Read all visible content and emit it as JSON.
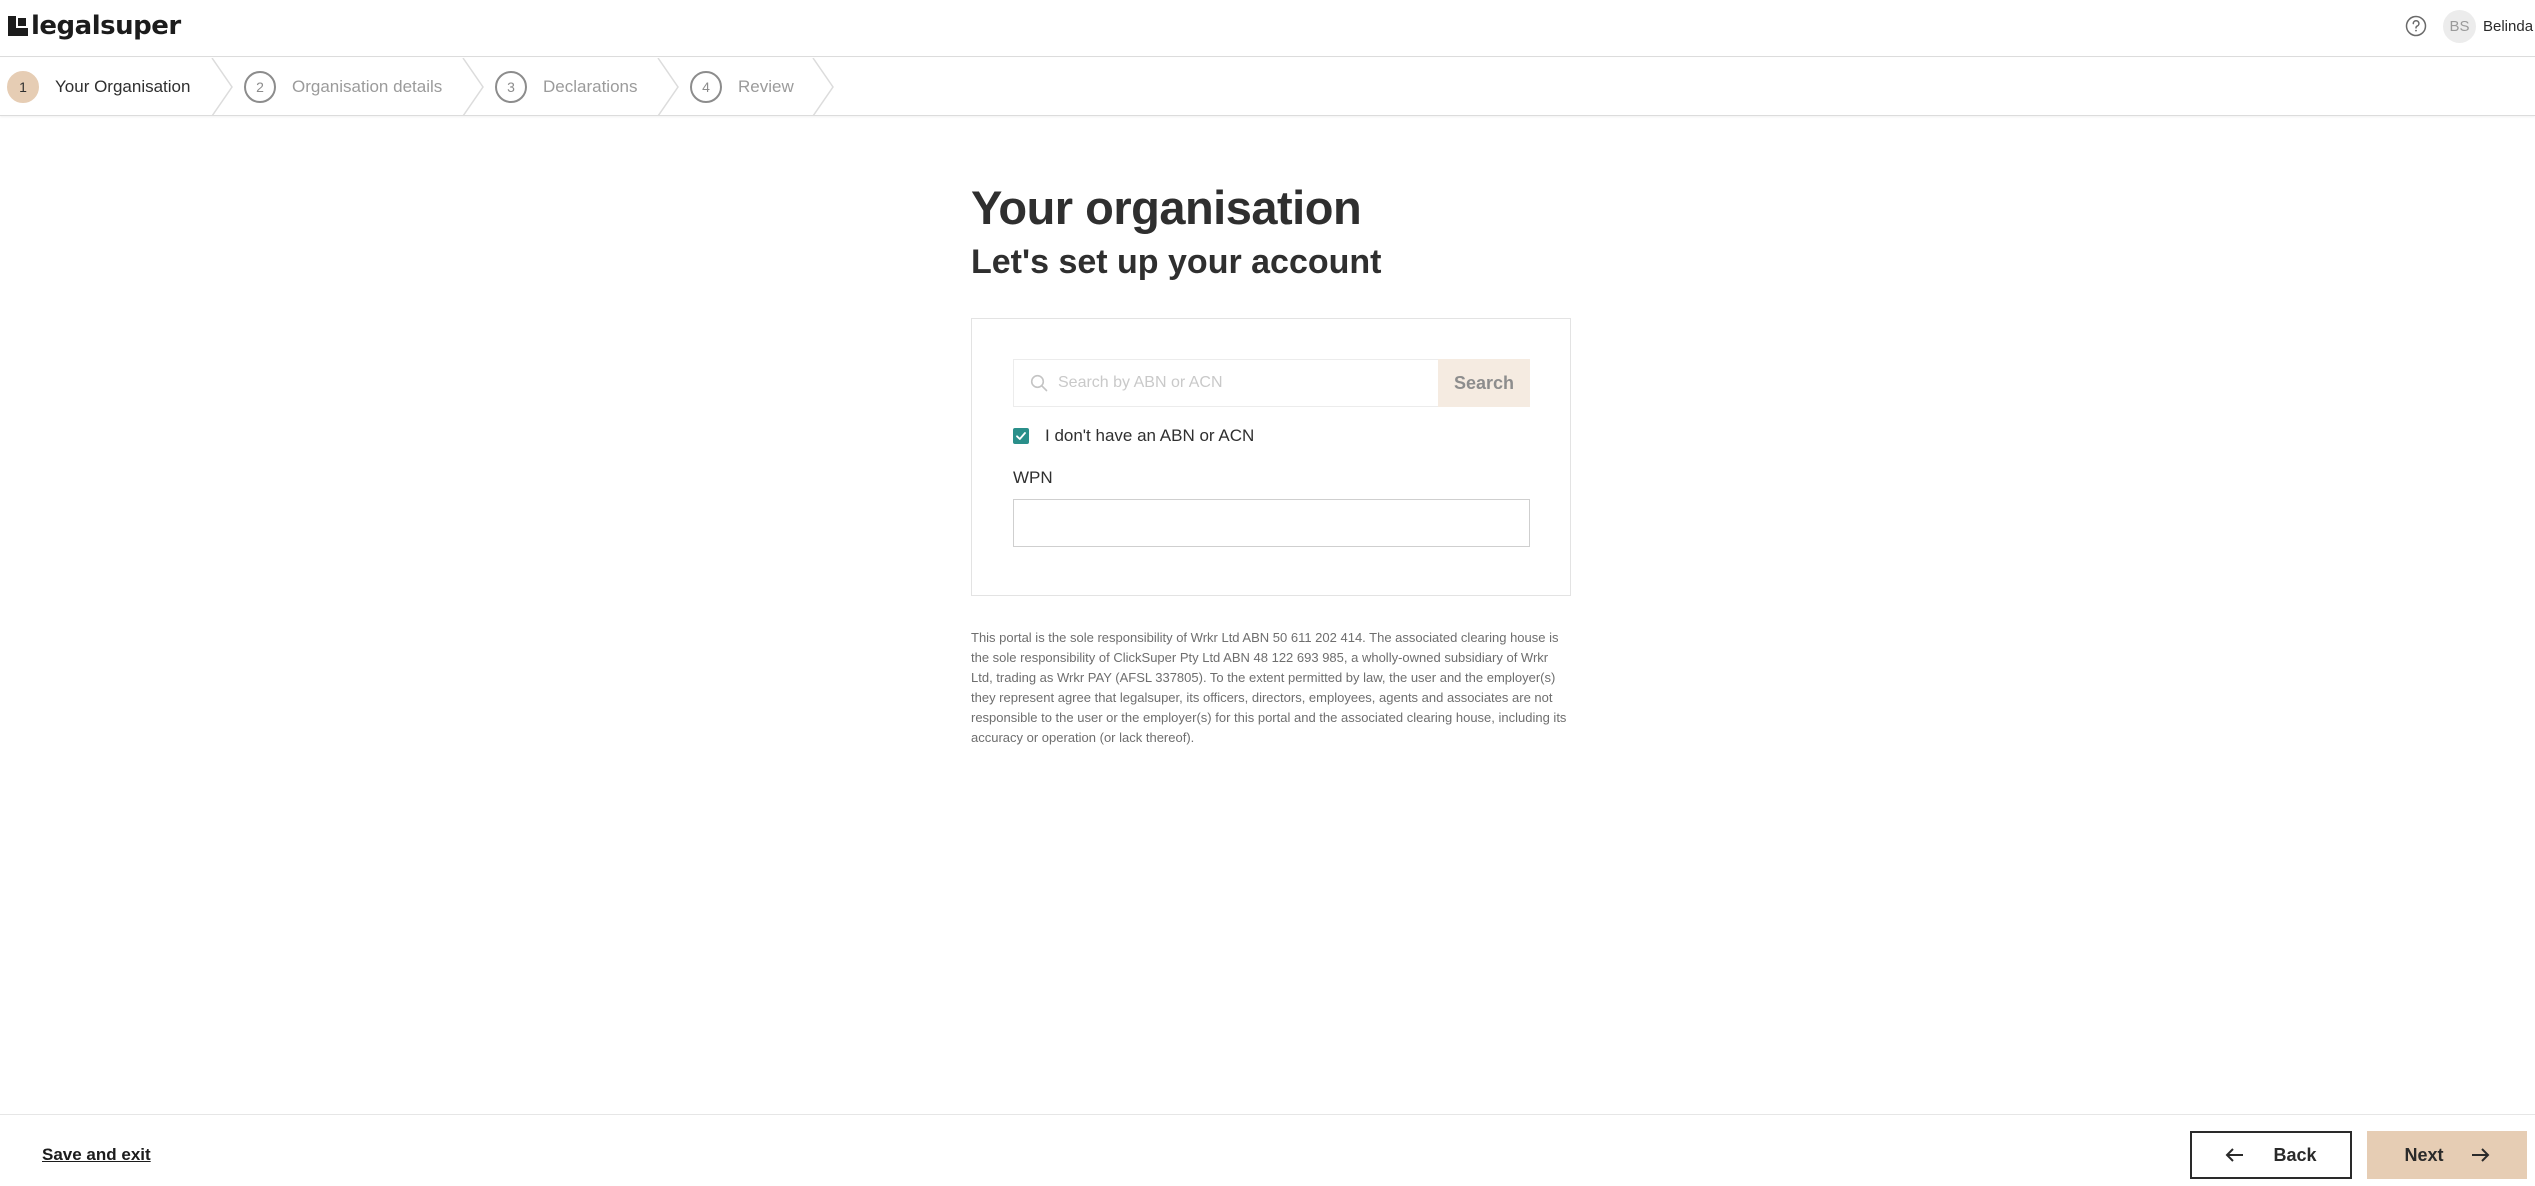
{
  "header": {
    "brand": "legalsuper",
    "avatar_initials": "BS",
    "user_name": "Belinda",
    "help_icon": "question-circle-icon"
  },
  "stepper": {
    "steps": [
      {
        "number": "1",
        "label": "Your Organisation",
        "active": true
      },
      {
        "number": "2",
        "label": "Organisation details",
        "active": false
      },
      {
        "number": "3",
        "label": "Declarations",
        "active": false
      },
      {
        "number": "4",
        "label": "Review",
        "active": false
      }
    ]
  },
  "main": {
    "title": "Your organisation",
    "subtitle": "Let's set up your account",
    "search": {
      "placeholder": "Search by ABN or ACN",
      "value": "",
      "button_label": "Search",
      "icon": "search-icon"
    },
    "no_abn_checkbox": {
      "label": "I don't have an ABN or ACN",
      "checked": true
    },
    "wpn": {
      "label": "WPN",
      "value": ""
    },
    "disclaimer": "This portal is the sole responsibility of Wrkr Ltd ABN 50 611 202 414. The associated clearing house is the sole responsibility of ClickSuper Pty Ltd ABN 48 122 693 985, a wholly-owned subsidiary of Wrkr Ltd, trading as Wrkr PAY (AFSL 337805). To the extent permitted by law, the user and the employer(s) they represent agree that legalsuper, its officers, directors, employees, agents and associates are not responsible to the user or the employer(s) for this portal and the associated clearing house, including its accuracy or operation (or lack thereof)."
  },
  "footer": {
    "save_exit_label": "Save and exit",
    "back_label": "Back",
    "next_label": "Next"
  },
  "colors": {
    "accent": "#e6cdb4",
    "checkbox": "#2a8f8a",
    "text": "#2f2f2f",
    "muted": "#9b9b9b"
  }
}
